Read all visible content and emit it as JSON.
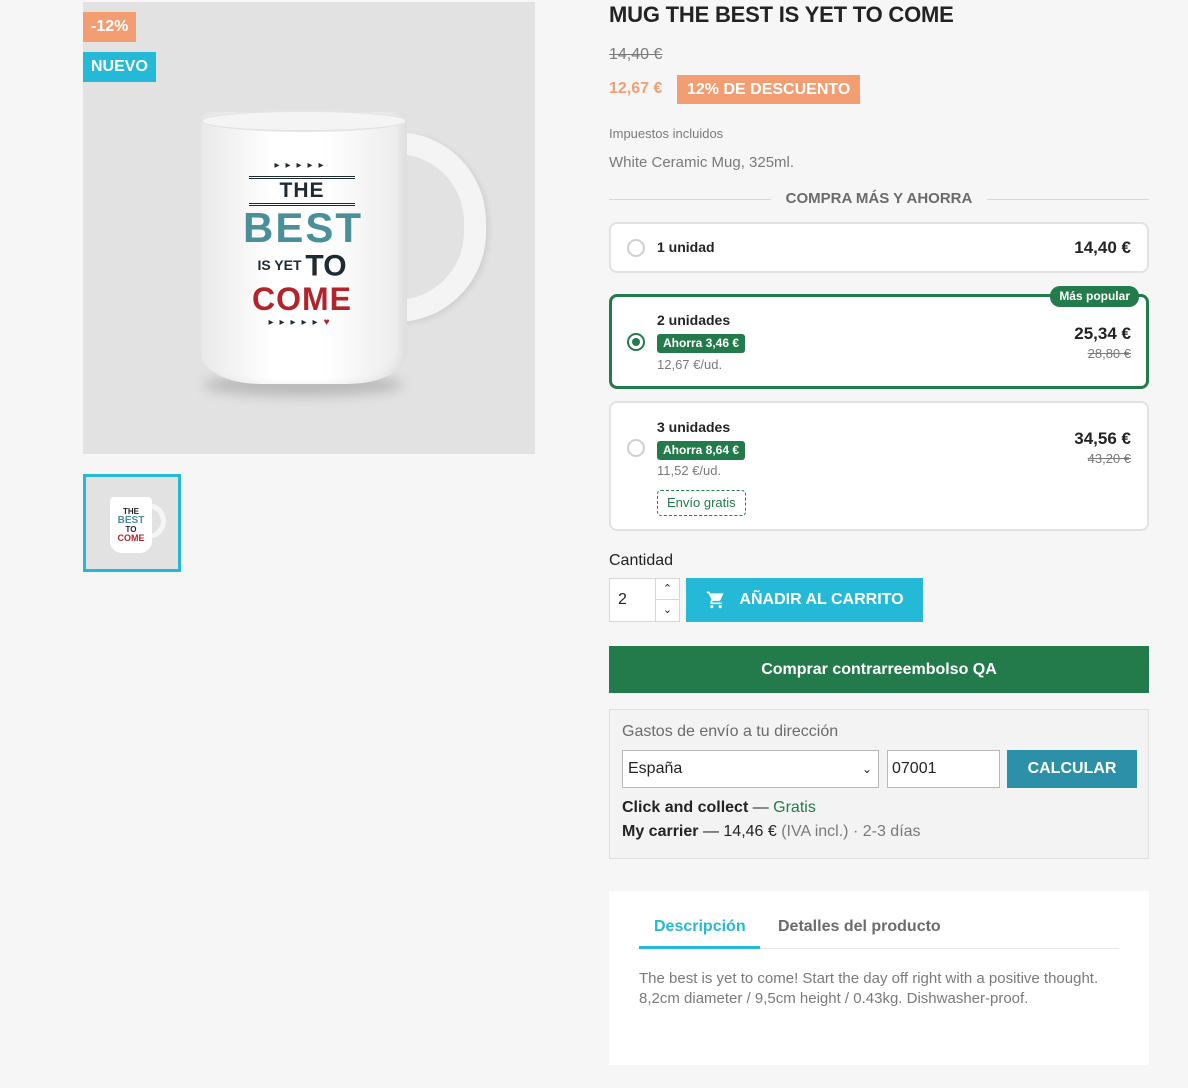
{
  "flags": {
    "discount": "-12%",
    "new": "NUEVO"
  },
  "product": {
    "title": "MUG THE BEST IS YET TO COME",
    "old_price": "14,40 €",
    "price": "12,67 €",
    "discount_label": "12% DE DESCUENTO",
    "tax_label": "Impuestos incluidos",
    "short_description": "White Ceramic Mug, 325ml."
  },
  "mug_print": {
    "line1": "THE",
    "line2": "BEST",
    "line3a": "IS YET",
    "line3b": "TO",
    "line4": "COME"
  },
  "bundles": {
    "heading": "COMPRA MÁS Y AHORRA",
    "options": [
      {
        "label": "1 unidad",
        "price": "14,40 €"
      },
      {
        "label": "2 unidades",
        "save": "Ahorra 3,46 €",
        "unit_price": "12,67 €/ud.",
        "price": "25,34 €",
        "old_price": "28,80 €",
        "badge": "Más popular"
      },
      {
        "label": "3 unidades",
        "save": "Ahorra 8,64 €",
        "unit_price": "11,52 €/ud.",
        "price": "34,56 €",
        "old_price": "43,20 €",
        "extra": "Envío gratis"
      }
    ]
  },
  "quantity": {
    "label": "Cantidad",
    "value": "2"
  },
  "add_to_cart_label": "AÑADIR AL CARRITO",
  "cod_label": "Comprar contrarreembolso QA",
  "shipping": {
    "title": "Gastos de envío a tu dirección",
    "country": "España",
    "zip": "07001",
    "calc_label": "CALCULAR",
    "carriers": [
      {
        "name": "Click and collect",
        "sep": " — ",
        "price": "Gratis"
      },
      {
        "name": "My carrier",
        "sep": " — ",
        "price": "14,46 €",
        "note": " (IVA incl.)",
        "delay": " · 2-3 días"
      }
    ]
  },
  "tabs": {
    "description": "Descripción",
    "details": "Detalles del producto",
    "content": "The best is yet to come! Start the day off right with a positive thought. 8,2cm diameter / 9,5cm height / 0.43kg. Dishwasher-proof."
  },
  "colors": {
    "accent": "#24b9d7",
    "discount": "#f39d72",
    "success": "#237a4b"
  }
}
